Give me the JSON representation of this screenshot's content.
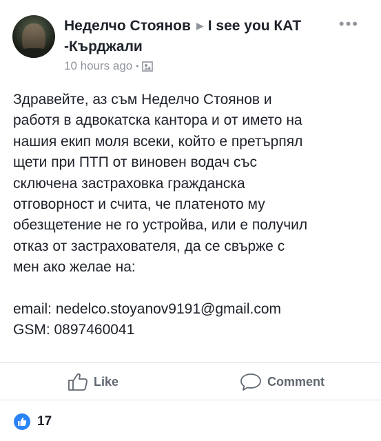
{
  "post": {
    "author": "Неделчо Стоянов",
    "target_group": "I see you КАТ -Кърджали",
    "timestamp": "10 hours ago",
    "body_lines": [
      "Здравейте, аз съм Неделчо Стоянов и",
      "работя в адвокатска кантора и от името на",
      "нашия екип моля всеки, който е претърпял",
      "щети при ПТП от виновен водач със",
      "сключена застраховка гражданска",
      "отговорност и счита, че платеното му",
      "обезщетение не го устройва, или е получил",
      "отказ от застрахователя, да се свърже с",
      "мен ако желае на:"
    ],
    "email_line": "email: nedelco.stoyanov9191@gmail.com",
    "gsm_line": "GSM: 0897460041"
  },
  "actions": {
    "like_label": "Like",
    "comment_label": "Comment"
  },
  "reactions": {
    "count": "17"
  },
  "colors": {
    "like_blue": "#2a83f7",
    "secondary_text": "#90949c",
    "action_text": "#606770"
  },
  "icons": [
    "avatar-photo",
    "triangle-arrow",
    "privacy-icon",
    "more-icon",
    "thumbs-up-icon",
    "comment-bubble-icon",
    "like-reaction-icon"
  ]
}
